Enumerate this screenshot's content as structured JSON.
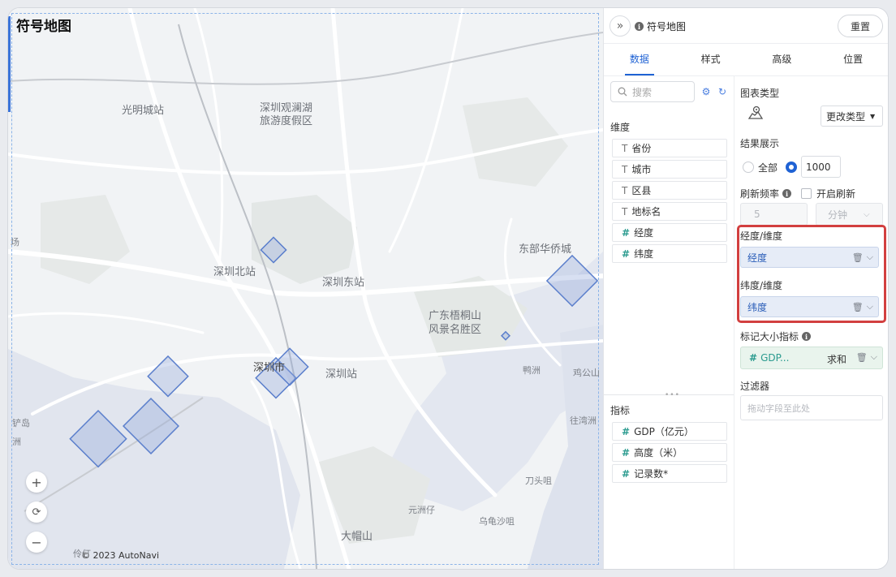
{
  "map": {
    "title": "符号地图",
    "copyright": "© 2023 AutoNavi",
    "places": [
      {
        "name": "光明城站",
        "cls": ""
      },
      {
        "name": "深圳观澜湖",
        "cls": ""
      },
      {
        "name": "旅游度假区",
        "cls": ""
      },
      {
        "name": "东部华侨城",
        "cls": ""
      },
      {
        "name": "深圳北站",
        "cls": ""
      },
      {
        "name": "深圳东站",
        "cls": ""
      },
      {
        "name": "广东梧桐山",
        "cls": ""
      },
      {
        "name": "风景名胜区",
        "cls": ""
      },
      {
        "name": "深圳市",
        "cls": ""
      },
      {
        "name": "深圳站",
        "cls": ""
      },
      {
        "name": "鸭洲",
        "cls": "small"
      },
      {
        "name": "鸡公山",
        "cls": "small"
      },
      {
        "name": "往湾洲",
        "cls": "small"
      },
      {
        "name": "刀头咀",
        "cls": "small"
      },
      {
        "name": "元洲仔",
        "cls": "small"
      },
      {
        "name": "乌龟沙咀",
        "cls": "small"
      },
      {
        "name": "大帽山",
        "cls": ""
      },
      {
        "name": "伶仃",
        "cls": "small"
      },
      {
        "name": "铲岛",
        "cls": "small"
      },
      {
        "name": "场",
        "cls": "small"
      },
      {
        "name": "洲",
        "cls": "small"
      }
    ],
    "zoom": {
      "in": "+",
      "reset": "⟳",
      "out": "−"
    }
  },
  "panel": {
    "collapse_icon": "»",
    "title": "符号地图",
    "reset": "重置",
    "tabs": [
      "数据",
      "样式",
      "高级",
      "位置"
    ],
    "active_tab": "数据",
    "search_placeholder": "搜索",
    "dimensions_label": "维度",
    "dimensions": [
      {
        "type": "T",
        "name": "省份"
      },
      {
        "type": "T",
        "name": "城市"
      },
      {
        "type": "T",
        "name": "区县"
      },
      {
        "type": "T",
        "name": "地标名"
      },
      {
        "type": "#",
        "name": "经度"
      },
      {
        "type": "#",
        "name": "纬度"
      }
    ],
    "measures_label": "指标",
    "measures": [
      {
        "type": "#",
        "name": "GDP（亿元）"
      },
      {
        "type": "#",
        "name": "高度（米）"
      },
      {
        "type": "#",
        "name": "记录数*"
      }
    ],
    "config": {
      "chart_type_label": "图表类型",
      "change_type": "更改类型",
      "result_label": "结果展示",
      "all": "全部",
      "limit_value": "1000",
      "refresh_label": "刷新频率",
      "auto_refresh": "开启刷新",
      "refresh_value": "5",
      "refresh_unit": "分钟",
      "lng_label": "经度/维度",
      "lng_value": "经度",
      "lat_label": "纬度/维度",
      "lat_value": "纬度",
      "size_label": "标记大小指标",
      "size_value": "GDP...",
      "size_agg": "求和",
      "filter_label": "过滤器",
      "filter_placeholder": "拖动字段至此处"
    }
  }
}
